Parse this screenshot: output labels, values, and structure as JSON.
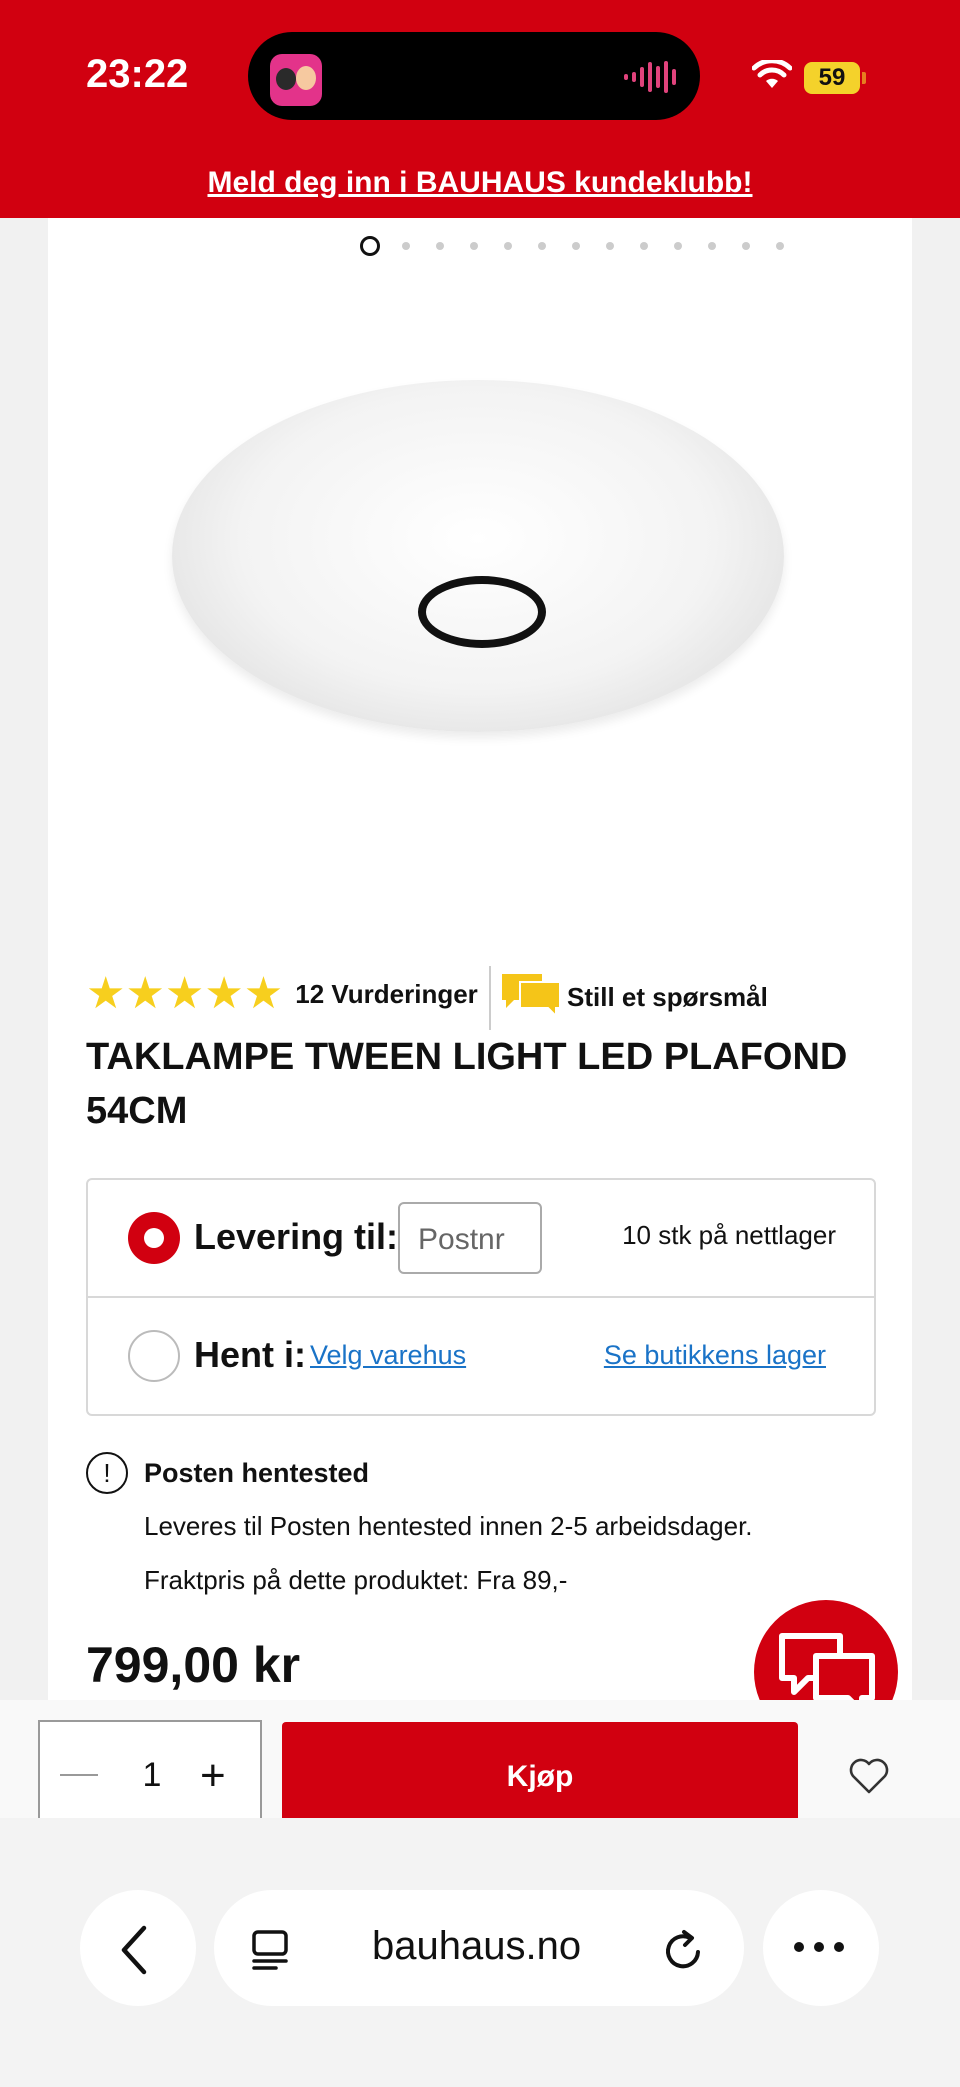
{
  "status_bar": {
    "time": "23:22",
    "battery": "59"
  },
  "banner": {
    "club_link": "Meld deg inn i BAUHAUS kundeklubb!"
  },
  "gallery": {
    "slide_count": 13,
    "active_index": 0
  },
  "product": {
    "rating_stars": "★★★★★",
    "rating_value": 5,
    "rating_count": "12 Vurderinger",
    "ask_question": "Still et spørsmål",
    "title": "TAKLAMPE TWEEN LIGHT LED PLAFOND 54CM",
    "price": "799,00 kr"
  },
  "delivery": {
    "deliver_label": "Levering til:",
    "postnr_placeholder": "Postnr",
    "stock_text": "10 stk på nettlager",
    "pickup_label": "Hent i:",
    "choose_store": "Velg varehus",
    "store_stock": "Se butikkens lager"
  },
  "shipping_info": {
    "title": "Posten hentested",
    "line1": "Leveres til Posten hentested innen 2-5 arbeidsdager.",
    "line2": "Fraktpris på dette produktet: Fra 89,-",
    "icon_glyph": "!"
  },
  "buy_bar": {
    "quantity": "1",
    "buy_label": "Kjøp"
  },
  "browser": {
    "url": "bauhaus.no"
  },
  "colors": {
    "brand_red": "#d10010",
    "star_yellow": "#f7cf1e",
    "link_blue": "#1a73c7",
    "ask_icon_yellow": "#f5c518"
  },
  "icons": [
    "wifi-icon",
    "battery-icon",
    "star-icon",
    "chat-bubble-icon",
    "info-icon",
    "chat-icon",
    "minus-icon",
    "plus-icon",
    "heart-icon",
    "back-chevron-icon",
    "tabs-icon",
    "reload-icon",
    "more-icon"
  ]
}
